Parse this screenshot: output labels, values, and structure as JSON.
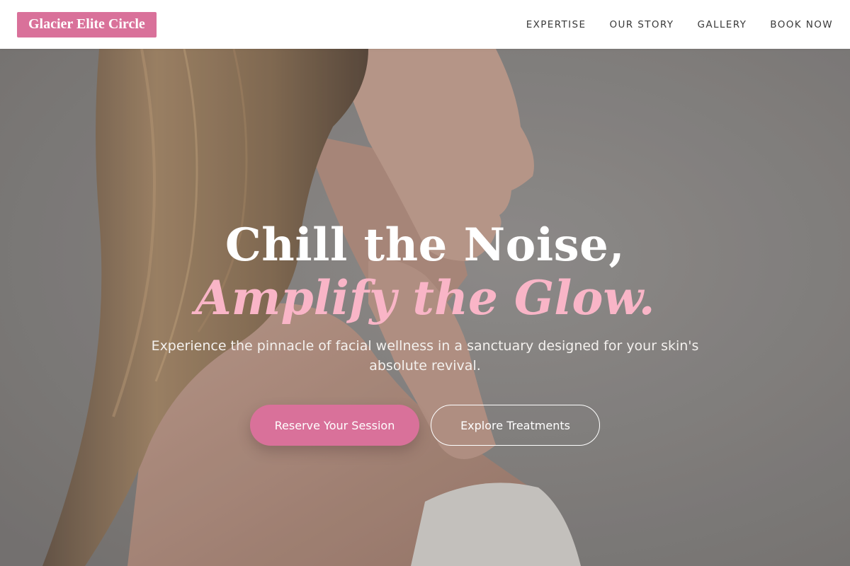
{
  "header": {
    "logo_text": "Glacier Elite Circle",
    "nav": [
      "EXPERTISE",
      "OUR STORY",
      "GALLERY",
      "BOOK NOW"
    ]
  },
  "hero": {
    "headline_line1": "Chill the Noise,",
    "headline_line2": "Amplify the Glow.",
    "subheading": "Experience the pinnacle of facial wellness in a sanctuary designed for your skin's absolute revival.",
    "primary_cta": "Reserve Your Session",
    "secondary_cta": "Explore Treatments"
  },
  "colors": {
    "brand_pink": "#d9719a",
    "accent_pink_text": "#f9b5c7",
    "header_bg": "#ffffff",
    "hero_bg": "#8a8886"
  }
}
